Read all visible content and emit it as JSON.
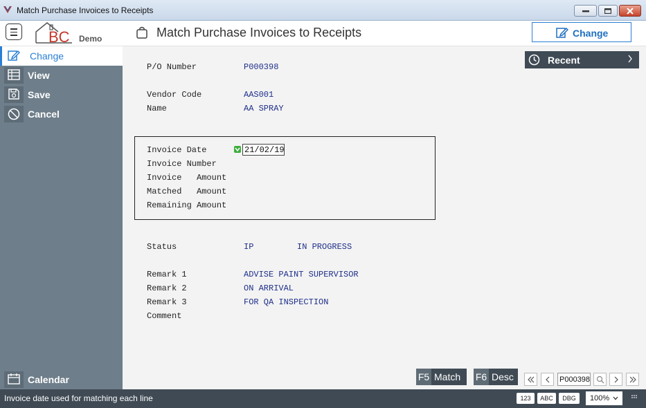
{
  "window": {
    "title": "Match Purchase Invoices to Receipts"
  },
  "header": {
    "logo_text": "BC",
    "logo_sub": "Demo",
    "page_title": "Match Purchase Invoices to Receipts",
    "change_label": "Change"
  },
  "sidebar": {
    "items": [
      {
        "label": "Change",
        "icon": "edit-icon",
        "active": true
      },
      {
        "label": "View",
        "icon": "table-icon"
      },
      {
        "label": "Save",
        "icon": "floppy-icon"
      },
      {
        "label": "Cancel",
        "icon": "cancel-icon"
      }
    ],
    "calendar_label": "Calendar"
  },
  "form": {
    "po_label": "P/O Number",
    "po_value": "P000398",
    "vendor_code_label": "Vendor Code",
    "vendor_code_value": "AAS001",
    "name_label": "Name",
    "name_value": "AA SPRAY",
    "invoice_date_label": "Invoice Date",
    "invoice_date_value": "21/02/19",
    "invoice_number_label": "Invoice Number",
    "invoice_amount_label": "Invoice   Amount",
    "matched_amount_label": "Matched   Amount",
    "remaining_amount_label": "Remaining Amount",
    "status_label": "Status",
    "status_code": "IP",
    "status_desc": "IN PROGRESS",
    "remark1_label": "Remark 1",
    "remark1_value": "ADVISE PAINT SUPERVISOR",
    "remark2_label": "Remark 2",
    "remark2_value": "ON ARRIVAL",
    "remark3_label": "Remark 3",
    "remark3_value": "FOR QA INSPECTION",
    "comment_label": "Comment"
  },
  "recent": {
    "label": "Recent"
  },
  "function_keys": [
    {
      "key": "F5",
      "label": "Match"
    },
    {
      "key": "F6",
      "label": "Desc"
    }
  ],
  "record_nav": {
    "current": "P000398"
  },
  "statusbar": {
    "message": "Invoice date used for matching each line",
    "chips": [
      "123",
      "ABC",
      "DBG"
    ],
    "zoom": "100%"
  },
  "colors": {
    "accent": "#2a7fd4",
    "sidebar": "#6e7e8a",
    "dark": "#3f4a54",
    "value_text": "#1f2f8a"
  }
}
